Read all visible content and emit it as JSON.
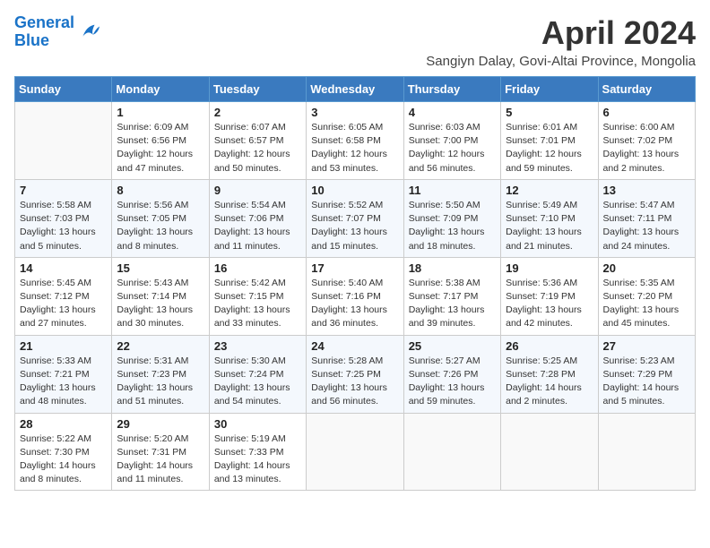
{
  "logo": {
    "line1": "General",
    "line2": "Blue"
  },
  "title": "April 2024",
  "location": "Sangiyn Dalay, Govi-Altai Province, Mongolia",
  "days_of_week": [
    "Sunday",
    "Monday",
    "Tuesday",
    "Wednesday",
    "Thursday",
    "Friday",
    "Saturday"
  ],
  "weeks": [
    [
      null,
      {
        "day": "1",
        "sunrise": "6:09 AM",
        "sunset": "6:56 PM",
        "daylight": "12 hours and 47 minutes."
      },
      {
        "day": "2",
        "sunrise": "6:07 AM",
        "sunset": "6:57 PM",
        "daylight": "12 hours and 50 minutes."
      },
      {
        "day": "3",
        "sunrise": "6:05 AM",
        "sunset": "6:58 PM",
        "daylight": "12 hours and 53 minutes."
      },
      {
        "day": "4",
        "sunrise": "6:03 AM",
        "sunset": "7:00 PM",
        "daylight": "12 hours and 56 minutes."
      },
      {
        "day": "5",
        "sunrise": "6:01 AM",
        "sunset": "7:01 PM",
        "daylight": "12 hours and 59 minutes."
      },
      {
        "day": "6",
        "sunrise": "6:00 AM",
        "sunset": "7:02 PM",
        "daylight": "13 hours and 2 minutes."
      }
    ],
    [
      {
        "day": "7",
        "sunrise": "5:58 AM",
        "sunset": "7:03 PM",
        "daylight": "13 hours and 5 minutes."
      },
      {
        "day": "8",
        "sunrise": "5:56 AM",
        "sunset": "7:05 PM",
        "daylight": "13 hours and 8 minutes."
      },
      {
        "day": "9",
        "sunrise": "5:54 AM",
        "sunset": "7:06 PM",
        "daylight": "13 hours and 11 minutes."
      },
      {
        "day": "10",
        "sunrise": "5:52 AM",
        "sunset": "7:07 PM",
        "daylight": "13 hours and 15 minutes."
      },
      {
        "day": "11",
        "sunrise": "5:50 AM",
        "sunset": "7:09 PM",
        "daylight": "13 hours and 18 minutes."
      },
      {
        "day": "12",
        "sunrise": "5:49 AM",
        "sunset": "7:10 PM",
        "daylight": "13 hours and 21 minutes."
      },
      {
        "day": "13",
        "sunrise": "5:47 AM",
        "sunset": "7:11 PM",
        "daylight": "13 hours and 24 minutes."
      }
    ],
    [
      {
        "day": "14",
        "sunrise": "5:45 AM",
        "sunset": "7:12 PM",
        "daylight": "13 hours and 27 minutes."
      },
      {
        "day": "15",
        "sunrise": "5:43 AM",
        "sunset": "7:14 PM",
        "daylight": "13 hours and 30 minutes."
      },
      {
        "day": "16",
        "sunrise": "5:42 AM",
        "sunset": "7:15 PM",
        "daylight": "13 hours and 33 minutes."
      },
      {
        "day": "17",
        "sunrise": "5:40 AM",
        "sunset": "7:16 PM",
        "daylight": "13 hours and 36 minutes."
      },
      {
        "day": "18",
        "sunrise": "5:38 AM",
        "sunset": "7:17 PM",
        "daylight": "13 hours and 39 minutes."
      },
      {
        "day": "19",
        "sunrise": "5:36 AM",
        "sunset": "7:19 PM",
        "daylight": "13 hours and 42 minutes."
      },
      {
        "day": "20",
        "sunrise": "5:35 AM",
        "sunset": "7:20 PM",
        "daylight": "13 hours and 45 minutes."
      }
    ],
    [
      {
        "day": "21",
        "sunrise": "5:33 AM",
        "sunset": "7:21 PM",
        "daylight": "13 hours and 48 minutes."
      },
      {
        "day": "22",
        "sunrise": "5:31 AM",
        "sunset": "7:23 PM",
        "daylight": "13 hours and 51 minutes."
      },
      {
        "day": "23",
        "sunrise": "5:30 AM",
        "sunset": "7:24 PM",
        "daylight": "13 hours and 54 minutes."
      },
      {
        "day": "24",
        "sunrise": "5:28 AM",
        "sunset": "7:25 PM",
        "daylight": "13 hours and 56 minutes."
      },
      {
        "day": "25",
        "sunrise": "5:27 AM",
        "sunset": "7:26 PM",
        "daylight": "13 hours and 59 minutes."
      },
      {
        "day": "26",
        "sunrise": "5:25 AM",
        "sunset": "7:28 PM",
        "daylight": "14 hours and 2 minutes."
      },
      {
        "day": "27",
        "sunrise": "5:23 AM",
        "sunset": "7:29 PM",
        "daylight": "14 hours and 5 minutes."
      }
    ],
    [
      {
        "day": "28",
        "sunrise": "5:22 AM",
        "sunset": "7:30 PM",
        "daylight": "14 hours and 8 minutes."
      },
      {
        "day": "29",
        "sunrise": "5:20 AM",
        "sunset": "7:31 PM",
        "daylight": "14 hours and 11 minutes."
      },
      {
        "day": "30",
        "sunrise": "5:19 AM",
        "sunset": "7:33 PM",
        "daylight": "14 hours and 13 minutes."
      },
      null,
      null,
      null,
      null
    ]
  ],
  "sunrise_label": "Sunrise:",
  "sunset_label": "Sunset:",
  "daylight_label": "Daylight:"
}
